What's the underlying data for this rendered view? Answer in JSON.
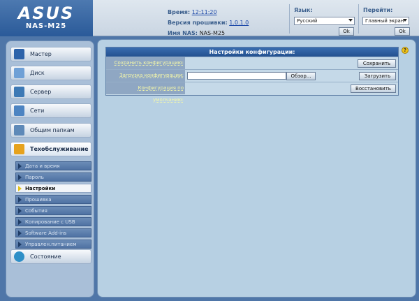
{
  "header": {
    "brand": "ASUS",
    "model": "NAS-M25",
    "time_label": "Время:",
    "time_value": "12:11:20",
    "firmware_label": "Версия прошивки:",
    "firmware_value": "1.0.1.0",
    "nas_name_label": "Имя NAS:",
    "nas_name_value": "NAS-M25",
    "language_label": "Язык:",
    "language_selected": "Русский",
    "language_ok": "Ok",
    "goto_label": "Перейти:",
    "goto_selected": "Главный экран",
    "goto_ok": "Ok"
  },
  "sidebar": {
    "items": [
      {
        "label": "Мастер",
        "icon": "wizard-icon"
      },
      {
        "label": "Диск",
        "icon": "disk-icon"
      },
      {
        "label": "Сервер",
        "icon": "server-icon"
      },
      {
        "label": "Сети",
        "icon": "network-icon"
      },
      {
        "label": "Общим папкам",
        "icon": "shared-folder-icon"
      },
      {
        "label": "Техобслуживание",
        "icon": "tools-icon"
      },
      {
        "label": "Состояние",
        "icon": "status-icon"
      }
    ],
    "subitems": [
      {
        "label": "Дата и время"
      },
      {
        "label": "Пароль"
      },
      {
        "label": "Настройки"
      },
      {
        "label": "Прошивка"
      },
      {
        "label": "События"
      },
      {
        "label": "Копирование с USB"
      },
      {
        "label": "Software Add-ins"
      },
      {
        "label": "Управлен.питанием"
      }
    ]
  },
  "panel": {
    "title": "Настройки конфигурации:",
    "rows": [
      {
        "label": "Сохранить конфигурацию:",
        "button": "Сохранить"
      },
      {
        "label": "Загрузка конфигурации:",
        "browse": "Обзор...",
        "button": "Загрузить"
      },
      {
        "label": "Конфигурация по умолчанию:",
        "button": "Восстановить"
      }
    ]
  },
  "help_symbol": "?"
}
